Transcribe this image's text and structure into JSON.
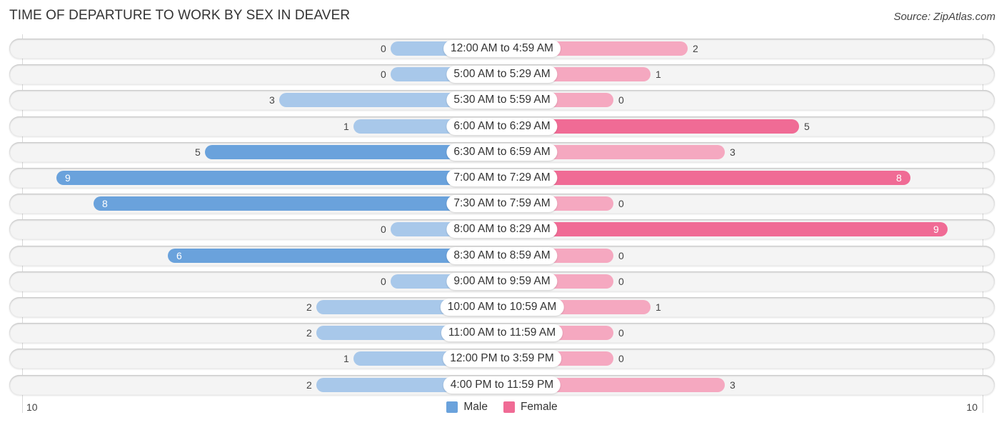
{
  "header": {
    "title": "TIME OF DEPARTURE TO WORK BY SEX IN DEAVER",
    "source": "Source: ZipAtlas.com"
  },
  "colors": {
    "male_strong": "#6aa2dc",
    "male_light": "#a8c8ea",
    "female_strong": "#f06b95",
    "female_light": "#f5a8c0"
  },
  "chart_data": {
    "type": "bar",
    "orientation": "horizontal-diverging",
    "title": "TIME OF DEPARTURE TO WORK BY SEX IN DEAVER",
    "categories": [
      "12:00 AM to 4:59 AM",
      "5:00 AM to 5:29 AM",
      "5:30 AM to 5:59 AM",
      "6:00 AM to 6:29 AM",
      "6:30 AM to 6:59 AM",
      "7:00 AM to 7:29 AM",
      "7:30 AM to 7:59 AM",
      "8:00 AM to 8:29 AM",
      "8:30 AM to 8:59 AM",
      "9:00 AM to 9:59 AM",
      "10:00 AM to 10:59 AM",
      "11:00 AM to 11:59 AM",
      "12:00 PM to 3:59 PM",
      "4:00 PM to 11:59 PM"
    ],
    "series": [
      {
        "name": "Male",
        "values": [
          0,
          0,
          3,
          1,
          5,
          9,
          8,
          0,
          6,
          0,
          2,
          2,
          1,
          2
        ]
      },
      {
        "name": "Female",
        "values": [
          2,
          1,
          0,
          5,
          3,
          8,
          0,
          9,
          0,
          0,
          1,
          0,
          0,
          3
        ]
      }
    ],
    "axis": {
      "left_tick": "10",
      "right_tick": "10",
      "range": [
        -10,
        10
      ]
    },
    "legend": {
      "position": "bottom-center",
      "entries": [
        "Male",
        "Female"
      ]
    },
    "xlabel": "",
    "ylabel": ""
  }
}
